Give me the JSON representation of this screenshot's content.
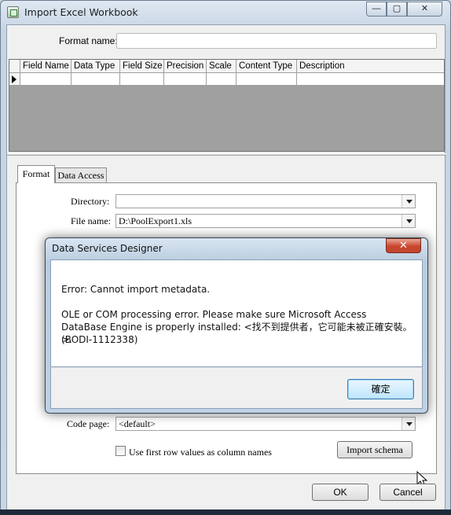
{
  "window": {
    "title": "Import Excel Workbook",
    "minimize_glyph": "—",
    "maximize_glyph": "▢",
    "close_glyph": "✕"
  },
  "format_name": {
    "label": "Format name:",
    "value": ""
  },
  "grid": {
    "columns": [
      "Field Name",
      "Data Type",
      "Field Size",
      "Precision",
      "Scale",
      "Content Type",
      "Description"
    ]
  },
  "tabs": [
    {
      "label": "Format",
      "active": true
    },
    {
      "label": "Data Access",
      "active": false
    }
  ],
  "form": {
    "directory": {
      "label": "Directory:",
      "value": ""
    },
    "file_name": {
      "label": "File name:",
      "value": "D:\\PoolExport1.xls"
    },
    "code_page": {
      "label": "Code page:",
      "value": "<default>"
    },
    "first_row_checkbox": {
      "label": "Use first row values as column names",
      "checked": false
    },
    "import_schema_label": "Import schema"
  },
  "footer": {
    "ok_label": "OK",
    "cancel_label": "Cancel"
  },
  "dialog": {
    "title": "Data Services Designer",
    "close_glyph": "✕",
    "line1": "Error: Cannot import metadata.",
    "line2": "OLE or COM processing error. Please make sure Microsoft Access DataBase Engine is properly installed: <找不到提供者，它可能未被正確安裝。>.",
    "line3": "(BODI-1112338)",
    "confirm_label": "確定"
  },
  "colors": {
    "close_red": "#c9452d",
    "grid_gray": "#a0a0a0",
    "focus_blue": "#3c7fb1"
  }
}
